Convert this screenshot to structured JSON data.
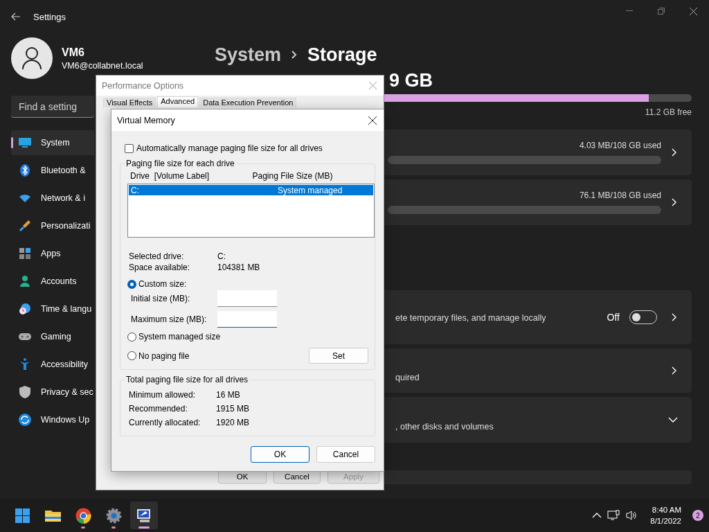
{
  "settings_window": {
    "title": "Settings"
  },
  "profile": {
    "name": "VM6",
    "email": "VM6@collabnet.local"
  },
  "search": {
    "placeholder": "Find a setting"
  },
  "sidebar": {
    "items": [
      {
        "label": "System",
        "selected": true
      },
      {
        "label": "Bluetooth &",
        "selected": false
      },
      {
        "label": "Network & i",
        "selected": false
      },
      {
        "label": "Personalizati",
        "selected": false
      },
      {
        "label": "Apps",
        "selected": false
      },
      {
        "label": "Accounts",
        "selected": false
      },
      {
        "label": "Time & langu",
        "selected": false
      },
      {
        "label": "Gaming",
        "selected": false
      },
      {
        "label": "Accessibility",
        "selected": false
      },
      {
        "label": "Privacy & sec",
        "selected": false
      },
      {
        "label": "Windows Up",
        "selected": false
      }
    ]
  },
  "breadcrumb": {
    "parent": "System",
    "current": "Storage"
  },
  "storage": {
    "total": "9 GB",
    "level": 0.91,
    "free": "11.2 GB free"
  },
  "usage_cards": [
    {
      "reading": "4.03 MB/108 GB used",
      "level": 0
    },
    {
      "reading": "76.1 MB/108 GB used",
      "level": 0
    }
  ],
  "setting_cards": [
    {
      "kind": "toggle",
      "description": "ete temporary files, and manage locally",
      "state": "Off",
      "on": false
    },
    {
      "kind": "link",
      "description": "quired"
    },
    {
      "kind": "expand",
      "description": ", other disks and volumes"
    }
  ],
  "performance_options": {
    "title": "Performance Options",
    "tabs": [
      {
        "label": "Visual Effects",
        "selected": false
      },
      {
        "label": "Advanced",
        "selected": true
      },
      {
        "label": "Data Execution Prevention",
        "selected": false
      }
    ],
    "buttons": [
      {
        "label": "OK",
        "disabled": false
      },
      {
        "label": "Cancel",
        "disabled": false
      },
      {
        "label": "Apply",
        "disabled": true
      }
    ]
  },
  "virtual_memory": {
    "title": "Virtual Memory",
    "auto_manage": {
      "label": "Automatically manage paging file size for all drives",
      "checked": false
    },
    "drives_group": {
      "title": "Paging file size for each drive",
      "columns": [
        "Drive  [Volume Label]",
        "Paging File Size (MB)"
      ],
      "rows": [
        {
          "drive": "C:",
          "size": "System managed",
          "selected": true
        }
      ]
    },
    "details": [
      {
        "label": "Selected drive:",
        "value": "C:"
      },
      {
        "label": "Space available:",
        "value": "104381 MB"
      }
    ],
    "size_options": [
      {
        "label": "Custom size:",
        "selected": true
      },
      {
        "label": "System managed size",
        "selected": false
      },
      {
        "label": "No paging file",
        "selected": false
      }
    ],
    "fields": [
      {
        "label": "Initial size (MB):",
        "focused": false
      },
      {
        "label": "Maximum size (MB):",
        "focused": true
      }
    ],
    "set_button": "Set",
    "totals_group": {
      "title": "Total paging file size for all drives",
      "rows": [
        {
          "label": "Minimum allowed:",
          "value": "16 MB"
        },
        {
          "label": "Recommended:",
          "value": "1915 MB"
        },
        {
          "label": "Currently allocated:",
          "value": "1920 MB"
        }
      ]
    },
    "buttons": [
      {
        "label": "OK",
        "default": true
      },
      {
        "label": "Cancel",
        "default": false
      }
    ]
  },
  "taskbar": {
    "apps": [
      {
        "running": false,
        "selected": false
      },
      {
        "running": false,
        "selected": false
      },
      {
        "running": true,
        "selected": false
      },
      {
        "running": true,
        "selected": false
      },
      {
        "running": true,
        "selected": true
      }
    ],
    "clock": {
      "time": "8:40 AM",
      "date": "8/1/2022"
    },
    "notifications": "2"
  }
}
